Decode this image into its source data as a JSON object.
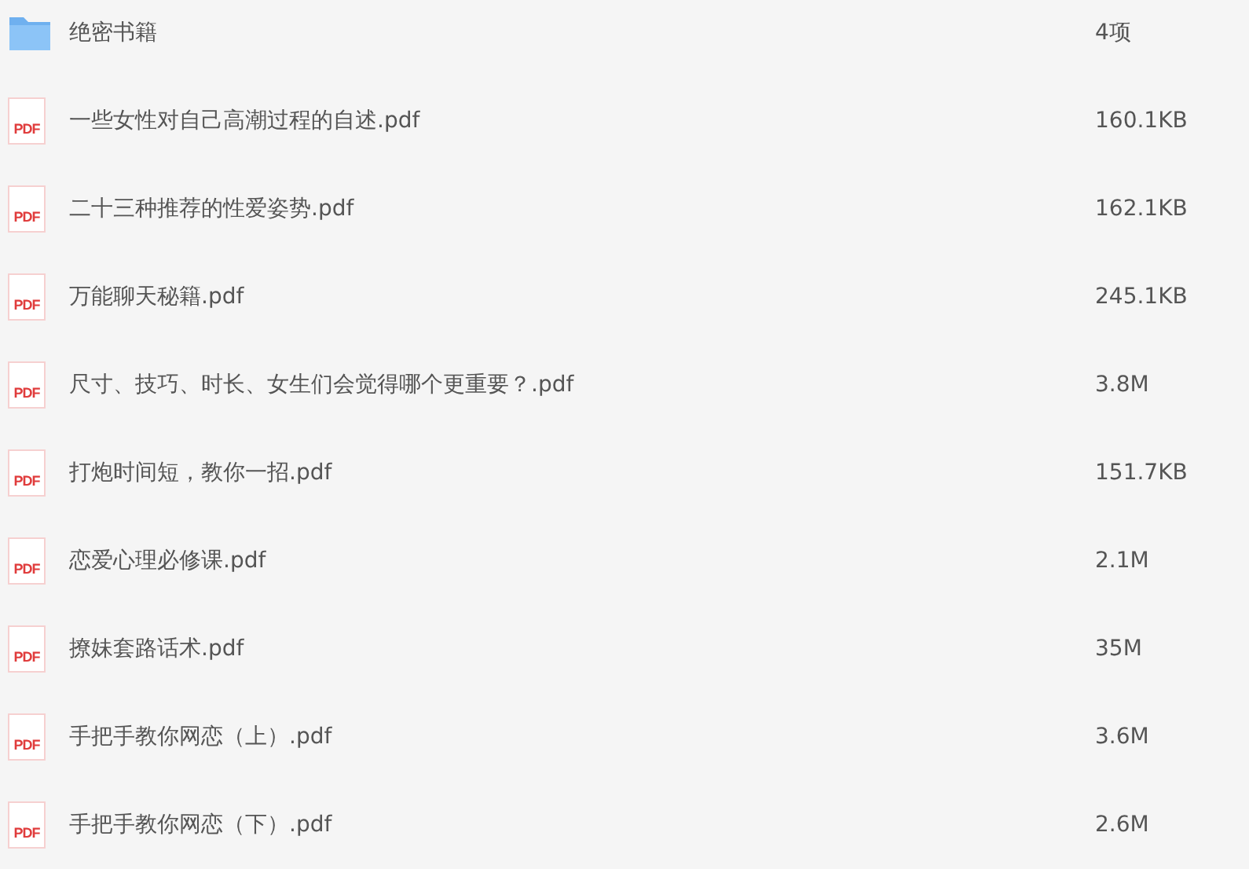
{
  "files": [
    {
      "kind": "folder",
      "name": "绝密书籍",
      "size": "4项"
    },
    {
      "kind": "pdf",
      "badge": "PDF",
      "name": "一些女性对自己高潮过程的自述.pdf",
      "size": "160.1KB"
    },
    {
      "kind": "pdf",
      "badge": "PDF",
      "name": "二十三种推荐的性爱姿势.pdf",
      "size": "162.1KB"
    },
    {
      "kind": "pdf",
      "badge": "PDF",
      "name": "万能聊天秘籍.pdf",
      "size": "245.1KB"
    },
    {
      "kind": "pdf",
      "badge": "PDF",
      "name": "尺寸、技巧、时长、女生们会觉得哪个更重要？.pdf",
      "size": "3.8M"
    },
    {
      "kind": "pdf",
      "badge": "PDF",
      "name": "打炮时间短，教你一招.pdf",
      "size": "151.7KB"
    },
    {
      "kind": "pdf",
      "badge": "PDF",
      "name": "恋爱心理必修课.pdf",
      "size": "2.1M"
    },
    {
      "kind": "pdf",
      "badge": "PDF",
      "name": "撩妹套路话术.pdf",
      "size": "35M"
    },
    {
      "kind": "pdf",
      "badge": "PDF",
      "name": "手把手教你网恋（上）.pdf",
      "size": "3.6M"
    },
    {
      "kind": "pdf",
      "badge": "PDF",
      "name": "手把手教你网恋（下）.pdf",
      "size": "2.6M"
    }
  ]
}
